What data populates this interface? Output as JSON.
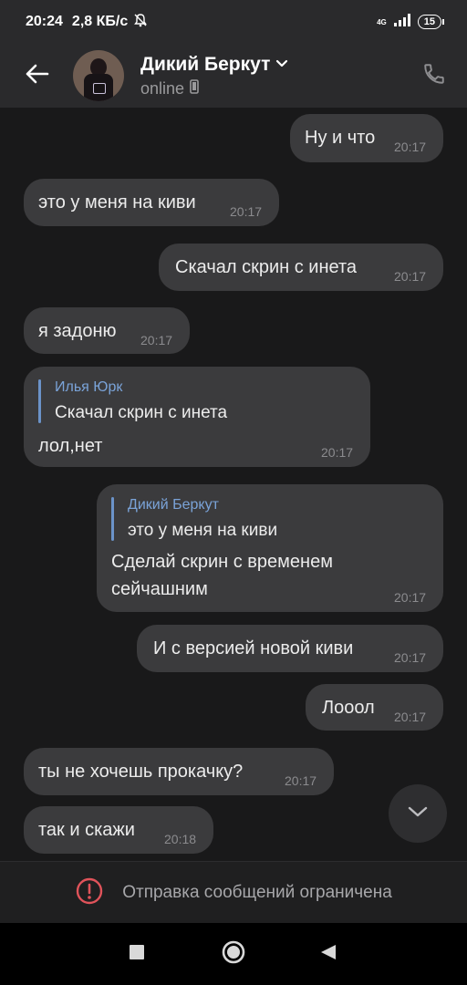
{
  "status_bar": {
    "time": "20:24",
    "speed": "2,8 КБ/с",
    "network": "4G",
    "battery": "15"
  },
  "header": {
    "contact_name": "Дикий Беркут",
    "status": "online"
  },
  "messages": [
    {
      "text": "Ну и что",
      "time": "20:17"
    },
    {
      "text": "это у меня на киви",
      "time": "20:17"
    },
    {
      "text": "Скачал скрин с инета",
      "time": "20:17"
    },
    {
      "text": "я задоню",
      "time": "20:17"
    },
    {
      "reply_author": "Илья Юрк",
      "reply_text": "Скачал скрин с инета",
      "text": "лол,нет",
      "time": "20:17"
    },
    {
      "reply_author": "Дикий Беркут",
      "reply_text": "это у меня на киви",
      "text_line1": "Сделай скрин с временем",
      "text_line2": "сейчашним",
      "time": "20:17"
    },
    {
      "text": "И с версией новой киви",
      "time": "20:17"
    },
    {
      "text": "Лооол",
      "time": "20:17"
    },
    {
      "text": "ты не хочешь прокачку?",
      "time": "20:17"
    },
    {
      "text": "так и скажи",
      "time": "20:18"
    }
  ],
  "restriction": {
    "text": "Отправка сообщений ограничена"
  },
  "icons": {
    "back": "arrow-left-icon",
    "dropdown": "chevron-down-icon",
    "phone_device": "phone-device-icon",
    "call": "phone-call-icon",
    "scroll": "chevron-down-icon",
    "warning": "alert-circle-icon",
    "nav_recents": "square-icon",
    "nav_home": "circle-icon",
    "nav_back": "triangle-back-icon"
  },
  "colors": {
    "background": "#19191a",
    "bubble": "#3b3b3d",
    "header": "#2a2a2c",
    "reply_accent": "#7aa3d8",
    "warning": "#e0535a"
  }
}
